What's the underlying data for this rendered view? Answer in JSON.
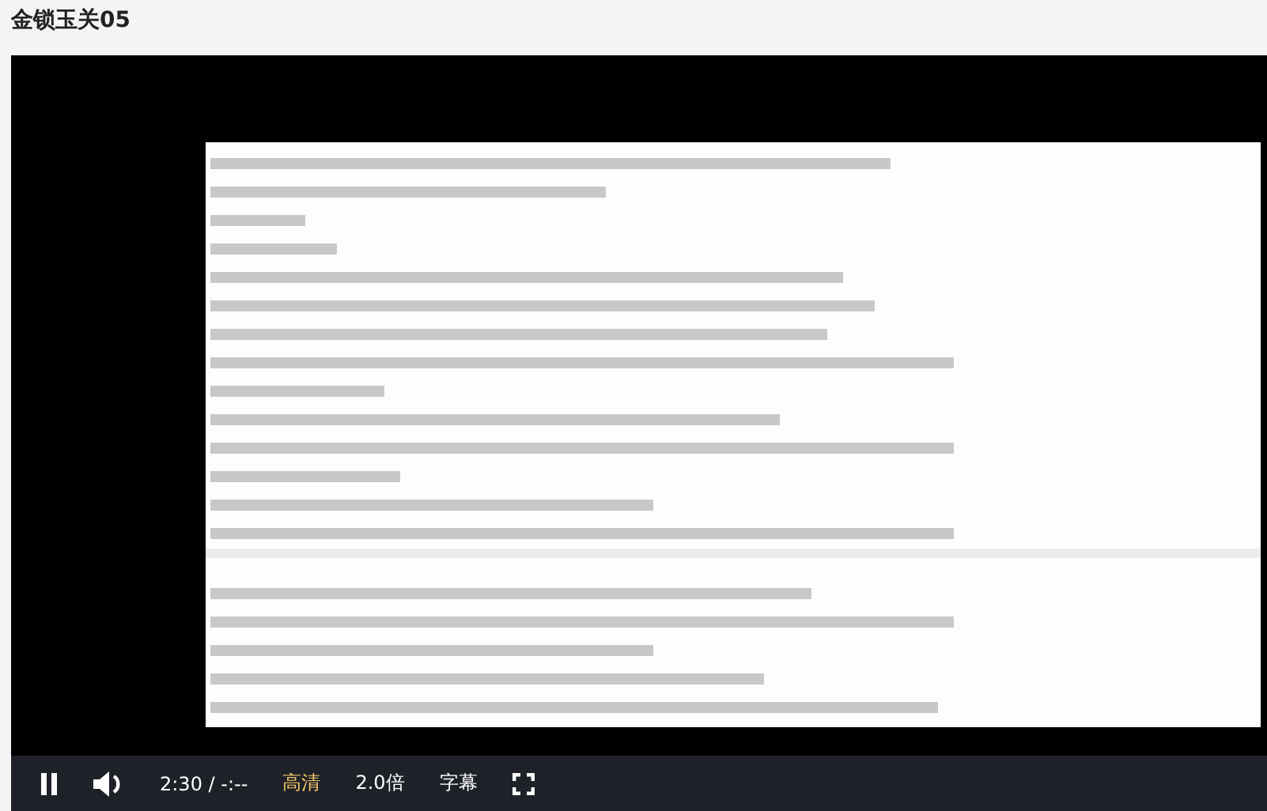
{
  "title": "金锁玉关05",
  "controls": {
    "playing": true,
    "time": "2:30",
    "separator": "/",
    "duration": "-:--",
    "buttons": [
      {
        "label": "高清",
        "selected": true
      },
      {
        "label": "2.0倍",
        "selected": false
      },
      {
        "label": "字幕",
        "selected": false
      }
    ]
  }
}
